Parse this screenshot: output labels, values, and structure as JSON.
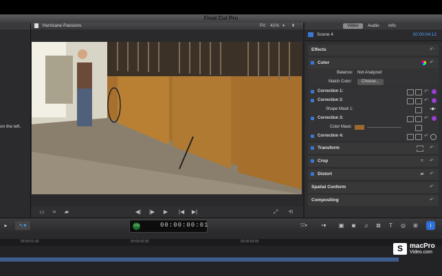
{
  "window": {
    "title": "Final Cut Pro"
  },
  "browser": {
    "hint": "on the left."
  },
  "viewer": {
    "clip_name": "Hurricane Passions",
    "fit_label": "Fit:",
    "zoom": "41%"
  },
  "inspector": {
    "tabs": [
      {
        "label": "Video"
      },
      {
        "label": "Audio"
      },
      {
        "label": "Info"
      }
    ],
    "scene": {
      "name": "Scene 4",
      "timecode": "00:00:04:12"
    },
    "sections": {
      "effects": "Effects",
      "color": "Color",
      "balance_label": "Balance:",
      "balance_value": "Not Analyzed",
      "match_label": "Match Color:",
      "match_button": "Choose...",
      "correction1": "Correction 1:",
      "correction2": "Correction 2:",
      "shape_mask": "Shape Mask 1:",
      "correction3": "Correction 3:",
      "color_mask": "Color Mask:",
      "correction4": "Correction 4:",
      "transform": "Transform",
      "crop": "Crop",
      "distort": "Distort",
      "spatial_conform": "Spatial Conform",
      "compositing": "Compositing"
    }
  },
  "toolbar": {
    "timecode": "00:00:00:01",
    "badge": "100"
  },
  "timeline": {
    "ruler": [
      "00:00:01:00",
      "00:00:02:00",
      "00:00:03:00"
    ]
  },
  "watermark": {
    "line1": "macPro",
    "line2": "Video.com",
    "glyph": "S"
  }
}
